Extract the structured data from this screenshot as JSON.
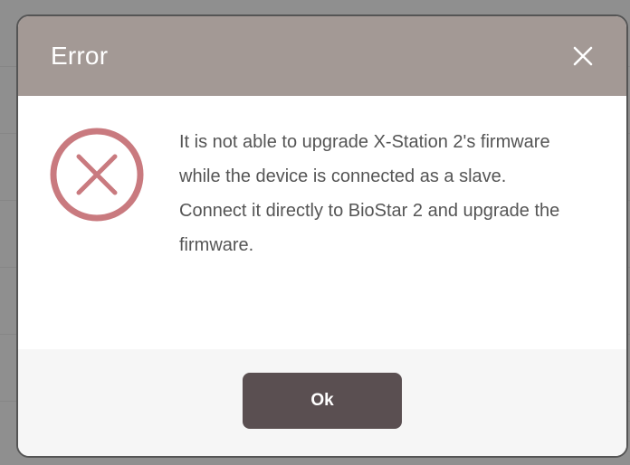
{
  "dialog": {
    "title": "Error",
    "close_icon": "close-icon",
    "message_icon": "error-circle-x-icon",
    "message": "It is not able to upgrade X-Station 2's firmware while the device is connected as a slave. Connect it directly to BioStar 2 and upgrade the firmware.",
    "ok_label": "Ok"
  },
  "colors": {
    "header": "#a39995",
    "ok_button": "#5a4f51",
    "error_icon": "#c97a7f",
    "text": "#555555"
  }
}
